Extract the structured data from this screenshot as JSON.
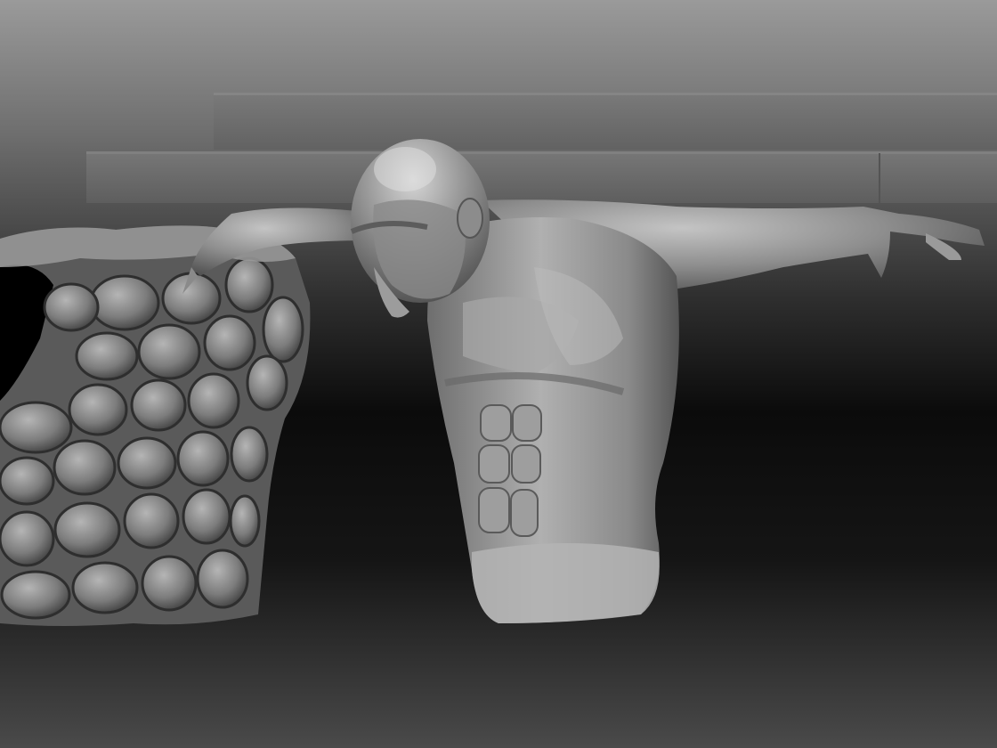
{
  "scene": {
    "kind": "3d-sculpt-viewport",
    "subjects": [
      "stacked-slab-top",
      "stacked-slab-bottom",
      "textured-rock-pillar",
      "sculpted-figure-torso"
    ],
    "colors": {
      "background_top": "#9a9a9a",
      "background_dark": "#0b0b0b",
      "background_bottom": "#4a4a4a",
      "clay_light": "#b8b8b8",
      "clay_mid": "#8a8a8a",
      "clay_dark": "#4a4a4a",
      "slab": "#6f6f6f"
    }
  }
}
